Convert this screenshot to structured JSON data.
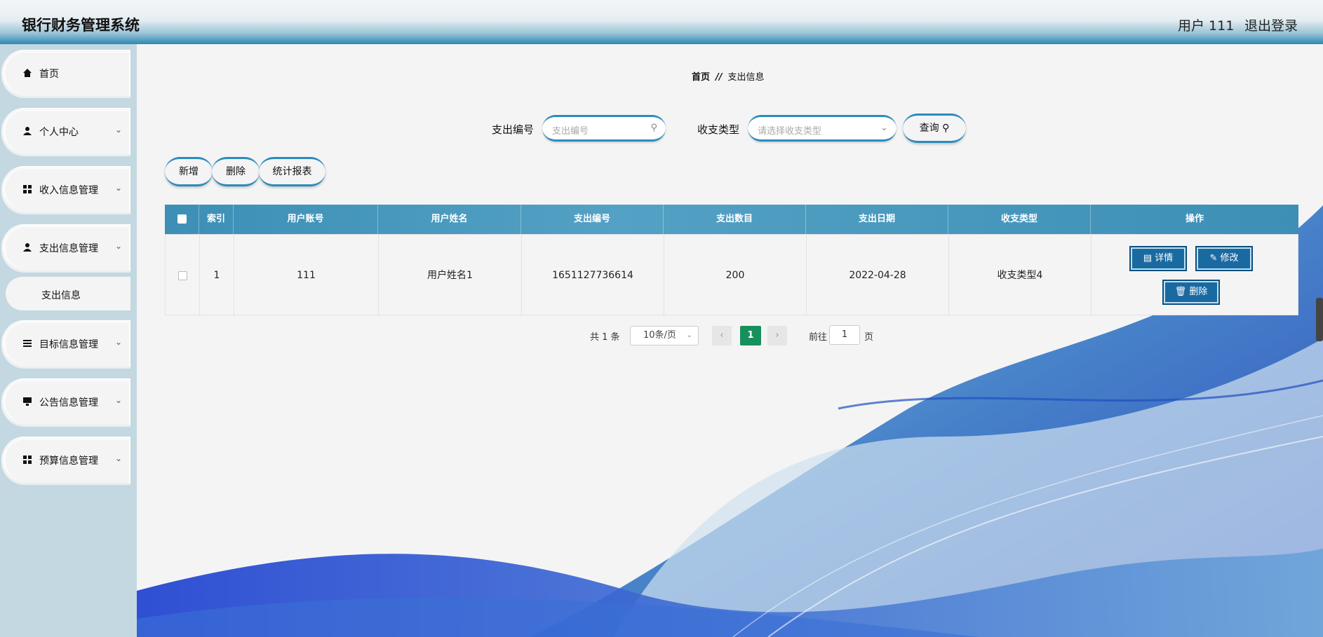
{
  "header": {
    "title": "银行财务管理系统",
    "user": "用户 111",
    "logout": "退出登录"
  },
  "sidebar": {
    "items": [
      {
        "label": "首页",
        "icon": "home-icon"
      },
      {
        "label": "个人中心",
        "icon": "person-icon"
      },
      {
        "label": "收入信息管理",
        "icon": "grid-icon"
      },
      {
        "label": "支出信息管理",
        "icon": "person-icon"
      },
      {
        "label": "目标信息管理",
        "icon": "list-icon"
      },
      {
        "label": "公告信息管理",
        "icon": "monitor-icon"
      },
      {
        "label": "预算信息管理",
        "icon": "grid-icon"
      }
    ],
    "sub_item": "支出信息"
  },
  "breadcrumb": {
    "home": "首页",
    "separator": "//",
    "current": "支出信息"
  },
  "search": {
    "code_label": "支出编号",
    "code_placeholder": "支出编号",
    "type_label": "收支类型",
    "type_placeholder": "请选择收支类型",
    "query_button": "查询"
  },
  "toolbar": {
    "add": "新增",
    "delete": "删除",
    "report": "统计报表"
  },
  "table": {
    "columns": [
      "索引",
      "用户账号",
      "用户姓名",
      "支出编号",
      "支出数目",
      "支出日期",
      "收支类型",
      "操作"
    ],
    "rows": [
      {
        "index": "1",
        "account": "111",
        "name": "用户姓名1",
        "code": "1651127736614",
        "amount": "200",
        "date": "2022-04-28",
        "type": "收支类型4"
      }
    ],
    "actions": {
      "detail": "详情",
      "edit": "修改",
      "delete": "删除"
    }
  },
  "pagination": {
    "total": "共 1 条",
    "page_size": "10条/页",
    "current_page": "1",
    "goto_prefix": "前往",
    "goto_value": "1",
    "goto_suffix": "页"
  },
  "colors": {
    "accent": "#2a8cbd",
    "table_header": "#4a9bc0",
    "action_button": "#1a6aa2",
    "page_active": "#16915c"
  }
}
